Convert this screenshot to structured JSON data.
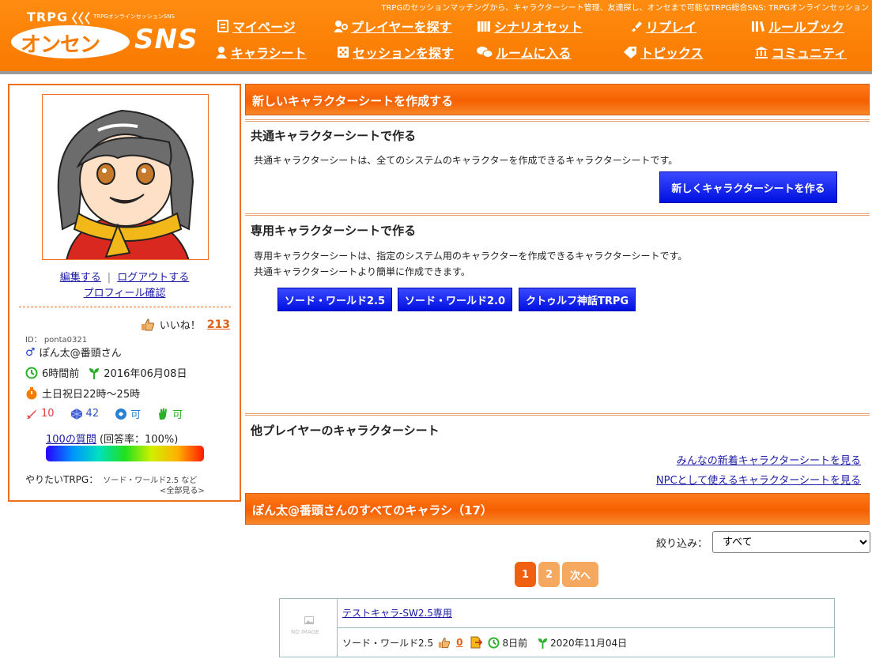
{
  "header": {
    "tagline": "TRPGのセッションマッチングから、キャラクターシート管理、友達探し、オンセまで可能なTRPG総合SNS: TRPGオンラインセッション",
    "logo": {
      "top": "TRPG",
      "waves": "〈〈〈",
      "sub": "TRPGオンラインセッションSNS",
      "name": "オンセン",
      "sns": "SNS"
    },
    "nav": [
      {
        "label": "マイページ",
        "icon": "mypage-icon"
      },
      {
        "label": "プレイヤーを探す",
        "icon": "players-icon"
      },
      {
        "label": "シナリオセット",
        "icon": "scenario-icon"
      },
      {
        "label": "リプレイ",
        "icon": "replay-icon"
      },
      {
        "label": "ルールブック",
        "icon": "rulebook-icon"
      },
      {
        "label": "キャラシート",
        "icon": "charasheet-icon"
      },
      {
        "label": "セッションを探す",
        "icon": "dice-icon"
      },
      {
        "label": "ルームに入る",
        "icon": "chat-icon"
      },
      {
        "label": "トピックス",
        "icon": "tag-icon"
      },
      {
        "label": "コミュニティ",
        "icon": "community-icon"
      }
    ]
  },
  "profile": {
    "edit": "編集する",
    "sep": "|",
    "logout": "ログアウトする",
    "confirm": "プロフィール確認",
    "likes_label": "いいね！",
    "likes_count": "213",
    "id": "ID： ponta0321",
    "gender_symbol": "♂",
    "name": "ぽん太@番頭さん",
    "last_login": "6時間前",
    "registered": "2016年06月08日",
    "play_time": "土日祝日22時～25時",
    "stat_sword": "10",
    "stat_dice": "42",
    "stat_gm": "可",
    "stat_hand": "可",
    "questions_link": "100の質問",
    "questions_rate": "(回答率：100%)",
    "want_label": "やりたいTRPG：",
    "want_value": "ソード・ワールド2.5 など",
    "want_all": "<全部見る>"
  },
  "main": {
    "create_title": "新しいキャラクターシートを作成する",
    "common_title": "共通キャラクターシートで作る",
    "common_desc": "共通キャラクターシートは、全てのシステムのキャラクターを作成できるキャラクターシートです。",
    "common_button": "新しくキャラクターシートを作る",
    "special_title": "専用キャラクターシートで作る",
    "special_desc1": "専用キャラクターシートは、指定のシステム用のキャラクターを作成できるキャラクターシートです。",
    "special_desc2": "共通キャラクターシートより簡単に作成できます。",
    "system_buttons": [
      "ソード・ワールド2.5",
      "ソード・ワールド2.0",
      "クトゥルフ神話TRPG"
    ],
    "others_title": "他プレイヤーのキャラクターシート",
    "others_link1": "みんなの新着キャラクターシートを見る",
    "others_link2": "NPCとして使えるキャラクターシートを見る",
    "all_title": "ぽん太@番頭さんのすべてのキャラシ（17）",
    "filter_label": "絞り込み：",
    "filter_value": "すべて",
    "pages": [
      "1",
      "2",
      "次へ"
    ],
    "card": {
      "noimage": "NO IMAGE",
      "name": "テストキャラ-SW2.5専用",
      "system": "ソード・ワールド2.5",
      "likes": "0",
      "updated": "8日前",
      "created": "2020年11月04日"
    }
  },
  "colors": {
    "orange": "#f57c00",
    "blue": "#0010e0",
    "link": "#1a1aa6"
  }
}
